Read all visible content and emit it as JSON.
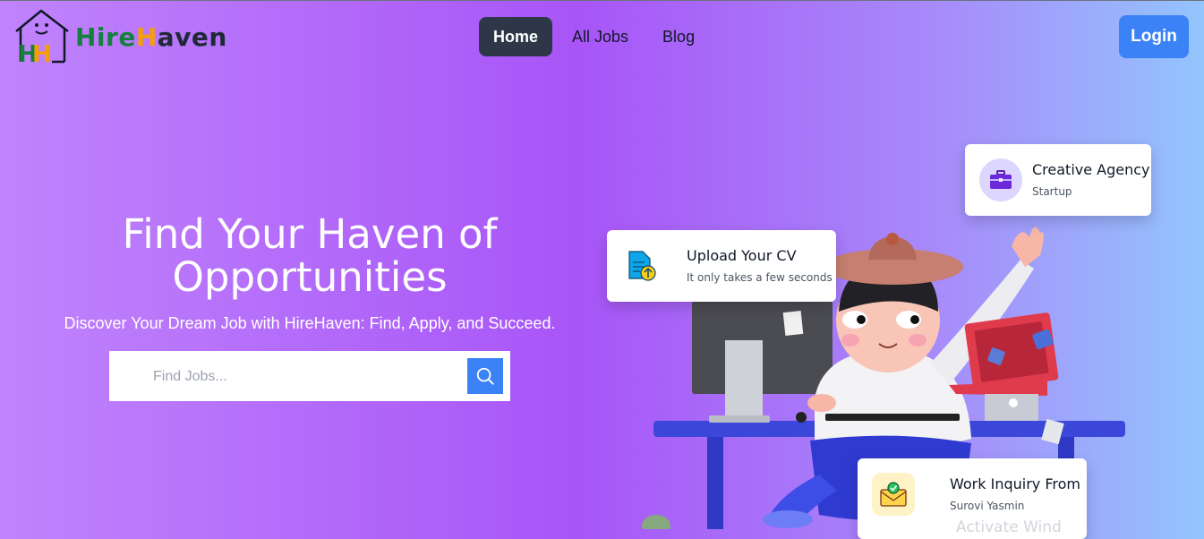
{
  "brand": {
    "part1": "Hire",
    "part2": "H",
    "part3": "aven"
  },
  "nav": {
    "items": [
      "Home",
      "All Jobs",
      "Blog"
    ],
    "active": "Home"
  },
  "login_label": "Login",
  "hero": {
    "title": "Find Your Haven of Opportunities",
    "subtitle": "Discover Your Dream Job with HireHaven: Find, Apply, and Succeed.",
    "search_placeholder": "Find Jobs..."
  },
  "cards": {
    "cv": {
      "title": "Upload Your CV",
      "subtitle": "It only takes a few seconds",
      "icon": "document-upload-icon"
    },
    "agency": {
      "title": "Creative Agency",
      "subtitle": "Startup",
      "icon": "briefcase-icon"
    },
    "work": {
      "title": "Work Inquiry From",
      "subtitle": "Surovi Yasmin",
      "icon": "envelope-check-icon",
      "faded_text": "Activate Wind"
    }
  },
  "colors": {
    "accent": "#3b82f6",
    "nav_active": "#2d3748",
    "brand_green": "#15803d",
    "brand_orange": "#f59e0b"
  }
}
